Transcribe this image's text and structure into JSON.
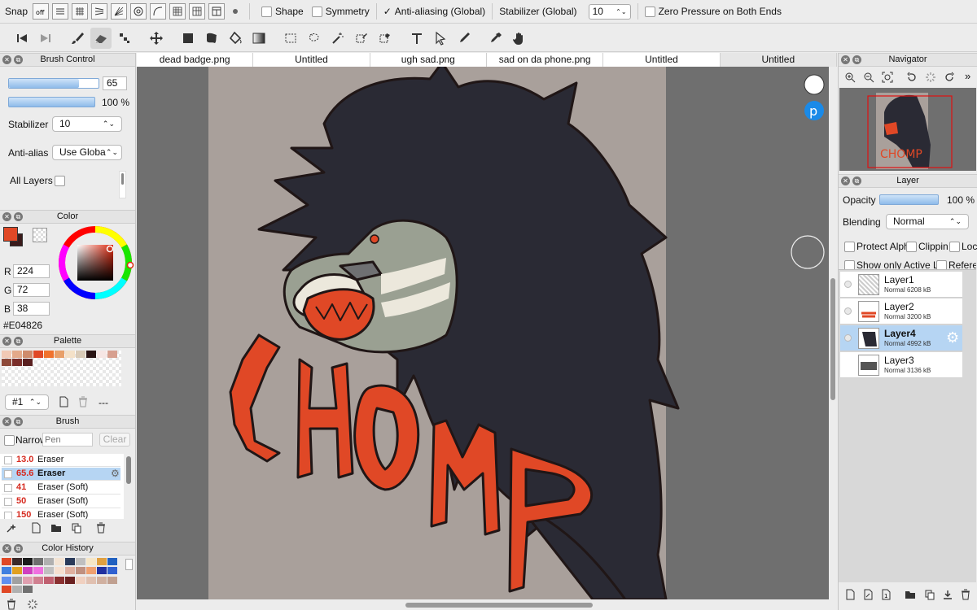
{
  "options_bar": {
    "snap_label": "Snap",
    "shape_label": "Shape",
    "symmetry_label": "Symmetry",
    "antialias_label": "Anti-aliasing (Global)",
    "stabilizer_label": "Stabilizer (Global)",
    "stabilizer_value": "10",
    "zero_pressure_label": "Zero Pressure on Both Ends"
  },
  "tabs": [
    {
      "label": "dead badge.png"
    },
    {
      "label": "Untitled"
    },
    {
      "label": "ugh sad.png"
    },
    {
      "label": "sad on da phone.png"
    },
    {
      "label": "Untitled"
    },
    {
      "label": "Untitled"
    }
  ],
  "brush_control": {
    "title": "Brush Control",
    "size_value": "65",
    "size_fill": 0.82,
    "opacity_value": "100 %",
    "opacity_fill": 1.0,
    "stabilizer_label": "Stabilizer",
    "stabilizer_value": "10",
    "antialias_label": "Anti-alias",
    "antialias_value": "Use Global S",
    "all_layers_label": "All Layers"
  },
  "color": {
    "title": "Color",
    "main_color": "#E04826",
    "r_label": "R",
    "r_value": "224",
    "g_label": "G",
    "g_value": "72",
    "b_label": "B",
    "b_value": "38",
    "hex": "#E04826"
  },
  "palette": {
    "title": "Palette",
    "swatches": [
      "#f1c9b5",
      "#e3a98a",
      "#cf8b6c",
      "#e04826",
      "#f0722d",
      "#e8a06a",
      "#f4e1c8",
      "#d9cbb8",
      "#2a1414",
      "#f6e6e4",
      "#d7a090",
      "#8e4a3a",
      "#7a2e2a",
      "#5a2020"
    ],
    "index_value": "#1",
    "name_value": "---"
  },
  "brush": {
    "title": "Brush",
    "narrow_label": "Narrow",
    "search_placeholder": "Pen",
    "clear_label": "Clear",
    "items": [
      {
        "size": "13.0",
        "name": "Eraser"
      },
      {
        "size": "65.6",
        "name": "Eraser"
      },
      {
        "size": "41",
        "name": "Eraser (Soft)"
      },
      {
        "size": "50",
        "name": "Eraser (Soft)"
      },
      {
        "size": "150",
        "name": "Eraser (Soft)"
      }
    ]
  },
  "color_history": {
    "title": "Color History",
    "swatches": [
      "#e04826",
      "#3a2a2a",
      "#1a1a1a",
      "#6e6e6e",
      "#b0b0b0",
      "#f3e3d3",
      "#2a3a5a",
      "#bfbfbf",
      "#f6e6c6",
      "#e0a040",
      "#2060c0",
      "#4080e0",
      "#e0a020",
      "#d040c0",
      "#f070e0",
      "#c0c0c0",
      "#f6e0d0",
      "#e0b0a0",
      "#c09080",
      "#f0a070",
      "#2030a0",
      "#3060d0",
      "#6090f0",
      "#a0a0a0",
      "#e0a0b0",
      "#d08090",
      "#c06070",
      "#8a3030",
      "#6a2020",
      "#f0d0c0",
      "#e0c0b0",
      "#d0b0a0",
      "#c0a090",
      "#e04826",
      "#b0b0b0",
      "#707070"
    ]
  },
  "navigator": {
    "title": "Navigator"
  },
  "layer": {
    "title": "Layer",
    "opacity_label": "Opacity",
    "opacity_value": "100 %",
    "opacity_fill": 1.0,
    "blending_label": "Blending",
    "blending_value": "Normal",
    "protect_label": "Protect Alph",
    "clipping_label": "Clippin",
    "lock_label": "Loc",
    "show_only_label": "Show only Active L",
    "reference_label": "Refere",
    "layers": [
      {
        "name": "Layer1",
        "info": "Normal 6208 kB"
      },
      {
        "name": "Layer2",
        "info": "Normal 3200 kB"
      },
      {
        "name": "Layer4",
        "info": "Normal 4992 kB"
      },
      {
        "name": "Layer3",
        "info": "Normal 3136 kB"
      }
    ]
  },
  "artwork": {
    "text": "CHOMP",
    "letter_color": "#E04826",
    "bg_color": "#A9A09B",
    "hair_color": "#2A2A34"
  }
}
